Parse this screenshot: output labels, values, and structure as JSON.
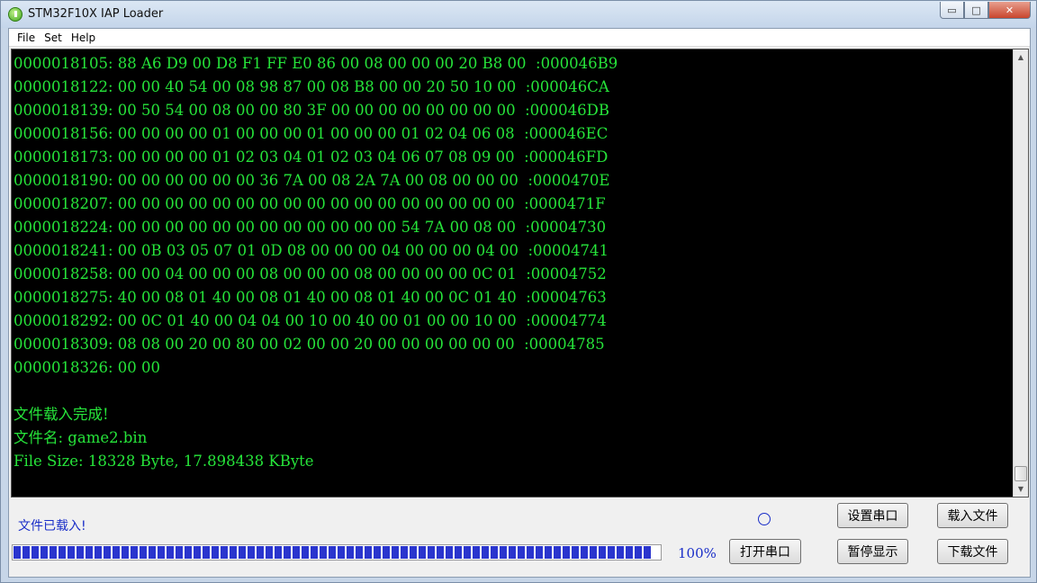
{
  "window": {
    "title": "STM32F10X IAP Loader",
    "controls": {
      "minimize": "▭",
      "maximize": "□",
      "close": "✕"
    }
  },
  "menu": {
    "items": [
      "File",
      "Set",
      "Help"
    ]
  },
  "console": {
    "lines": [
      "0000018105: 88 A6 D9 00 D8 F1 FF E0 86 00 08 00 00 00 20 B8 00  :000046B9",
      "0000018122: 00 00 40 54 00 08 98 87 00 08 B8 00 00 20 50 10 00  :000046CA",
      "0000018139: 00 50 54 00 08 00 00 80 3F 00 00 00 00 00 00 00 00  :000046DB",
      "0000018156: 00 00 00 00 01 00 00 00 01 00 00 00 01 02 04 06 08  :000046EC",
      "0000018173: 00 00 00 00 01 02 03 04 01 02 03 04 06 07 08 09 00  :000046FD",
      "0000018190: 00 00 00 00 00 00 36 7A 00 08 2A 7A 00 08 00 00 00  :0000470E",
      "0000018207: 00 00 00 00 00 00 00 00 00 00 00 00 00 00 00 00 00  :0000471F",
      "0000018224: 00 00 00 00 00 00 00 00 00 00 00 00 54 7A 00 08 00  :00004730",
      "0000018241: 00 0B 03 05 07 01 0D 08 00 00 00 04 00 00 00 04 00  :00004741",
      "0000018258: 00 00 04 00 00 00 08 00 00 00 08 00 00 00 00 0C 01  :00004752",
      "0000018275: 40 00 08 01 40 00 08 01 40 00 08 01 40 00 0C 01 40  :00004763",
      "0000018292: 00 0C 01 40 00 04 04 00 10 00 40 00 01 00 00 10 00  :00004774",
      "0000018309: 08 08 00 20 00 80 00 02 00 00 20 00 00 00 00 00 00  :00004785",
      "0000018326: 00 00",
      "",
      "文件载入完成!",
      "文件名: game2.bin",
      "File Size: 18328 Byte, 17.898438 KByte"
    ]
  },
  "status": {
    "message": "文件已载入!",
    "progress_percent": 100,
    "progress_label": "100%"
  },
  "buttons": {
    "set_serial": "设置串口",
    "load_file": "载入文件",
    "open_serial": "打开串口",
    "pause_display": "暂停显示",
    "download_file": "下载文件"
  },
  "colors": {
    "console_bg": "#000000",
    "console_text": "#26e43a",
    "status_text": "#1a2ec8",
    "progress_fill": "#2a35ce"
  }
}
